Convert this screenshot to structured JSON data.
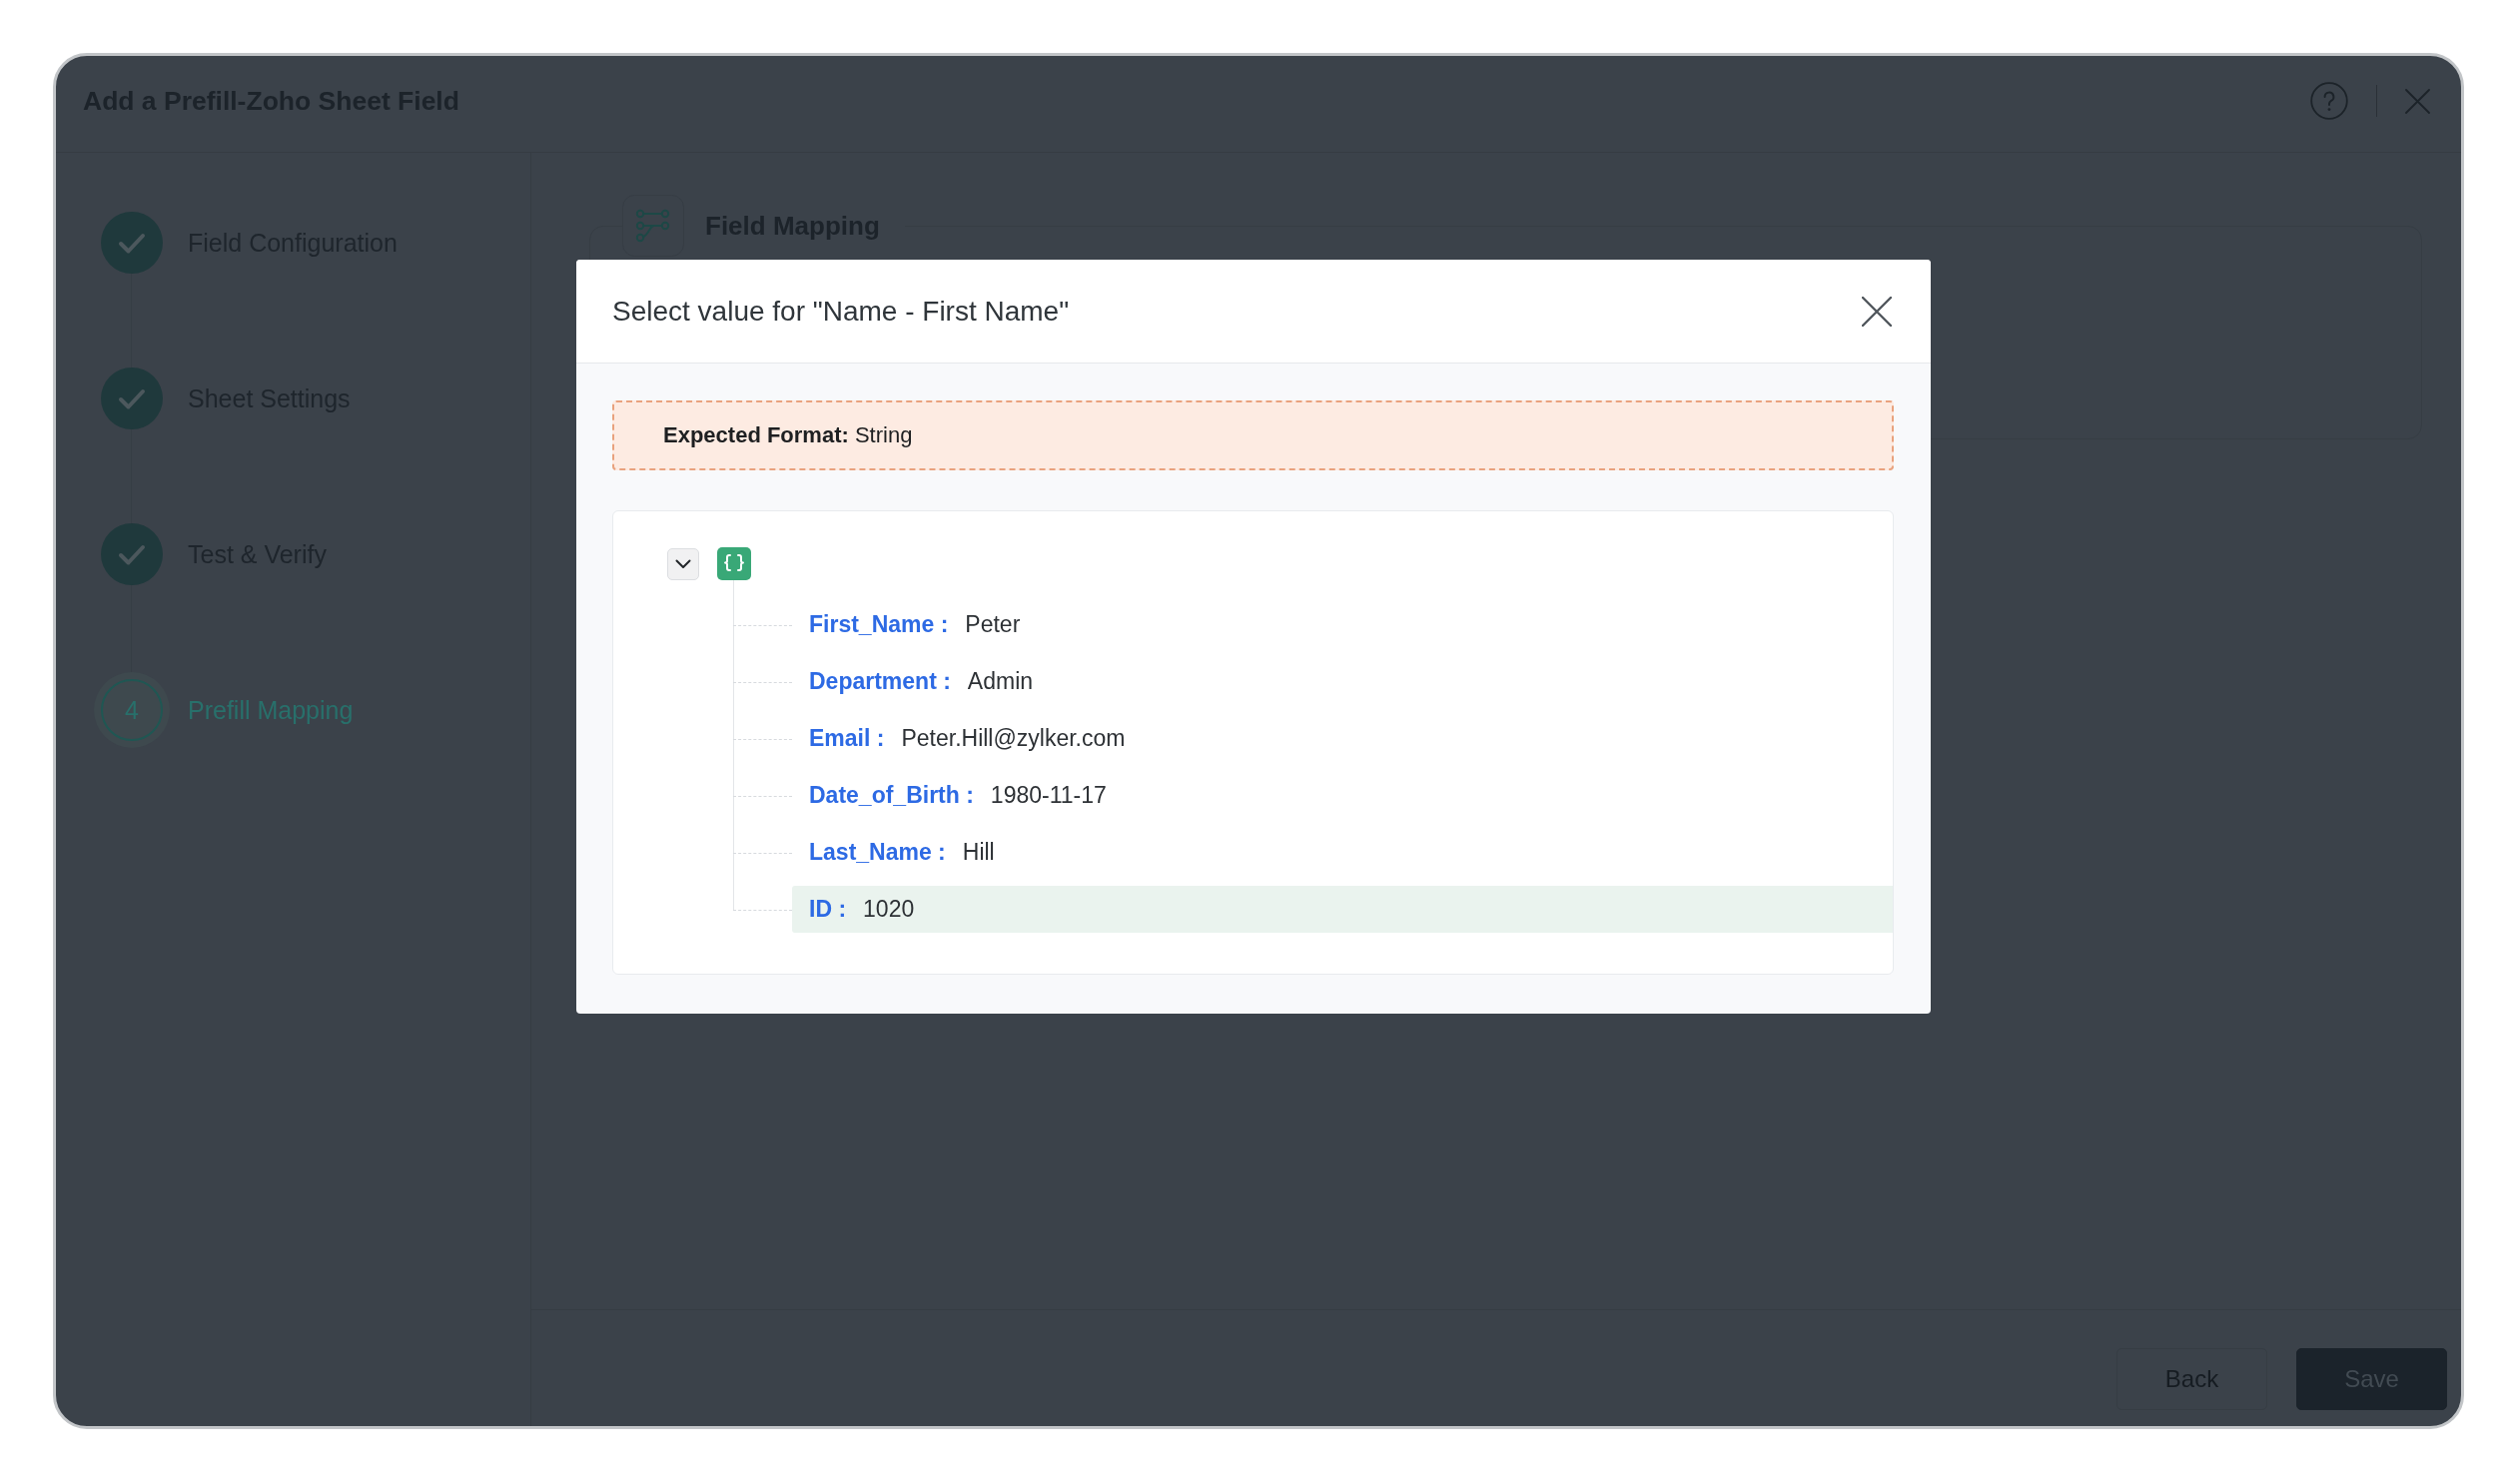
{
  "window": {
    "title": "Add a Prefill-Zoho Sheet Field"
  },
  "steps": [
    {
      "label": "Field Configuration",
      "completed": true,
      "selected": false
    },
    {
      "label": "Sheet Settings",
      "completed": true,
      "selected": false
    },
    {
      "label": "Test & Verify",
      "completed": true,
      "selected": false
    },
    {
      "label": "Prefill Mapping",
      "completed": false,
      "selected": true,
      "number": "4"
    }
  ],
  "section": {
    "title": "Field Mapping"
  },
  "footer": {
    "buttons": [
      {
        "label": "Back",
        "kind": "secondary"
      },
      {
        "label": "Save",
        "kind": "primary"
      }
    ]
  },
  "dialog": {
    "title": "Select value for \"Name - First Name\"",
    "expected_format": "**Expected Format:** String",
    "tree": {
      "expanded": true,
      "children": [
        {
          "key": "First_Name :",
          "value": "Peter",
          "selected": false
        },
        {
          "key": "Department :",
          "value": "Admin",
          "selected": false
        },
        {
          "key": "Email :",
          "value": "Peter.Hill@zylker.com",
          "selected": false
        },
        {
          "key": "Date_of_Birth :",
          "value": "1980-11-17",
          "selected": false
        },
        {
          "key": "Last_Name :",
          "value": "Hill",
          "selected": false
        },
        {
          "key": "ID :",
          "value": "1020",
          "selected": true
        }
      ]
    }
  }
}
